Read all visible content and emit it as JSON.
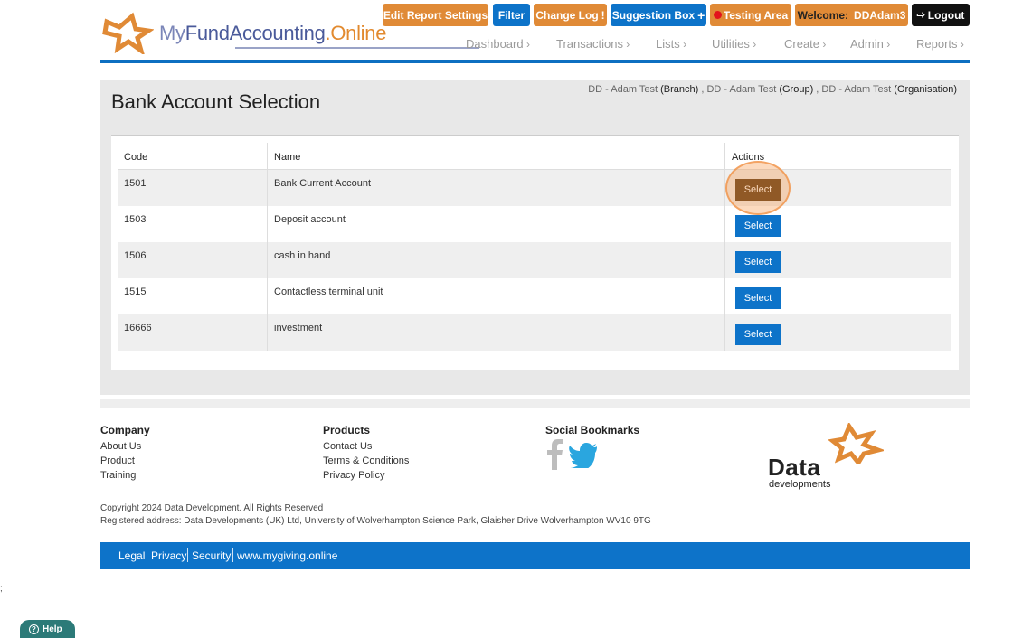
{
  "header": {
    "logo": {
      "my": "My",
      "fund": "FundAccounting",
      "online": ".Online"
    },
    "buttons": {
      "edit_report": "Edit Report Settings",
      "filter": "Filter",
      "change_log": "Change Log",
      "suggestion": "Suggestion Box",
      "testing": "Testing Area",
      "welcome_prefix": "Welcome:",
      "welcome_user": "DDAdam3",
      "logout": "Logout"
    },
    "nav": [
      "Dashboard",
      "Transactions",
      "Lists",
      "Utilities",
      "Create",
      "Admin",
      "Reports"
    ]
  },
  "page": {
    "title": "Bank Account Selection",
    "context": {
      "branch_name": "DD - Adam Test",
      "branch_tag": "(Branch)",
      "group_name": "DD - Adam Test",
      "group_tag": "(Group)",
      "org_name": "DD - Adam Test",
      "org_tag": "(Organisation)"
    }
  },
  "table": {
    "headers": [
      "Code",
      "Name",
      "Actions"
    ],
    "rows": [
      {
        "code": "1501",
        "name": "Bank Current Account",
        "action": "Select"
      },
      {
        "code": "1503",
        "name": "Deposit account",
        "action": "Select"
      },
      {
        "code": "1506",
        "name": "cash in hand",
        "action": "Select"
      },
      {
        "code": "1515",
        "name": "Contactless terminal unit",
        "action": "Select"
      },
      {
        "code": "16666",
        "name": "investment",
        "action": "Select"
      }
    ]
  },
  "footer": {
    "company": {
      "title": "Company",
      "links": [
        "About Us",
        "Product",
        "Training"
      ]
    },
    "products": {
      "title": "Products",
      "links": [
        "Contact Us",
        "Terms & Conditions",
        "Privacy Policy"
      ]
    },
    "social": {
      "title": "Social Bookmarks"
    },
    "brand": {
      "line1": "Data",
      "line2": "developments"
    },
    "copyright": "Copyright 2024 Data Development. All Rights Reserved",
    "address": "Registered address: Data Developments (UK) Ltd, University of Wolverhampton Science Park, Glaisher Drive Wolverhampton WV10 9TG",
    "legal_links": [
      "Legal",
      "Privacy",
      "Security",
      "www.mygiving.online"
    ]
  },
  "help": {
    "label": "Help"
  },
  "stray": {
    "text": ";"
  },
  "colors": {
    "brand_blue": "#0d73c9",
    "brand_orange": "#e08a36",
    "selected_button": "#5a3a16"
  }
}
